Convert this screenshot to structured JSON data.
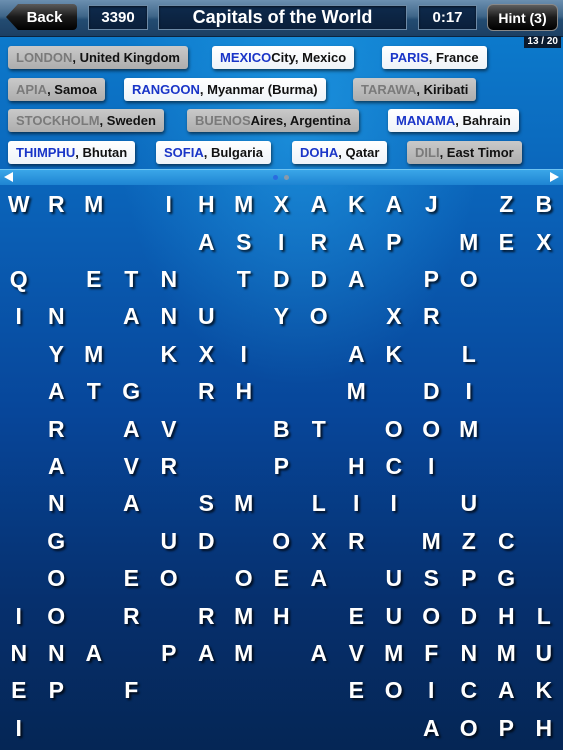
{
  "header": {
    "back_label": "Back",
    "score": "3390",
    "title": "Capitals of the World",
    "timer": "0:17",
    "hint_label": "Hint (3)",
    "page_indicator": "13 / 20"
  },
  "words": [
    {
      "capital": "LONDON",
      "country": ", United Kingdom",
      "found": true
    },
    {
      "capital": "MEXICO",
      "country": " City, Mexico",
      "found": false
    },
    {
      "capital": "PARIS",
      "country": ", France",
      "found": false
    },
    {
      "capital": "APIA",
      "country": ", Samoa",
      "found": true
    },
    {
      "capital": "RANGOON",
      "country": ", Myanmar (Burma)",
      "found": false
    },
    {
      "capital": "TARAWA",
      "country": ", Kiribati",
      "found": true
    },
    {
      "capital": "STOCKHOLM",
      "country": ", Sweden",
      "found": true
    },
    {
      "capital": "BUENOS",
      "country": " Aires, Argentina",
      "found": true
    },
    {
      "capital": "MANAMA",
      "country": ", Bahrain",
      "found": false
    },
    {
      "capital": "THIMPHU",
      "country": ", Bhutan",
      "found": false
    },
    {
      "capital": "SOFIA",
      "country": ", Bulgaria",
      "found": false
    },
    {
      "capital": "DOHA",
      "country": ", Qatar",
      "found": false
    },
    {
      "capital": "DILI",
      "country": ", East Timor",
      "found": true
    }
  ],
  "pager": {
    "pages": 2,
    "current": 1
  },
  "grid": [
    "WRM IHMXAKAJ ZB",
    "     ASIRAP MEX",
    "Q ETN TDDA PO  ",
    "IN ANU YO XR   ",
    " YM KXI  AK L  ",
    " ATG RH  M DI  ",
    " R AV  BT OOM  ",
    " A VR  P HCI   ",
    " N A SM LII U  ",
    " G  UD OXR MZC ",
    " O EO OEA USPG ",
    "IO R RMH EUODHL",
    "NNA PAM AVMFNMU",
    "EP F     EOICAK",
    "I          AOPH"
  ]
}
